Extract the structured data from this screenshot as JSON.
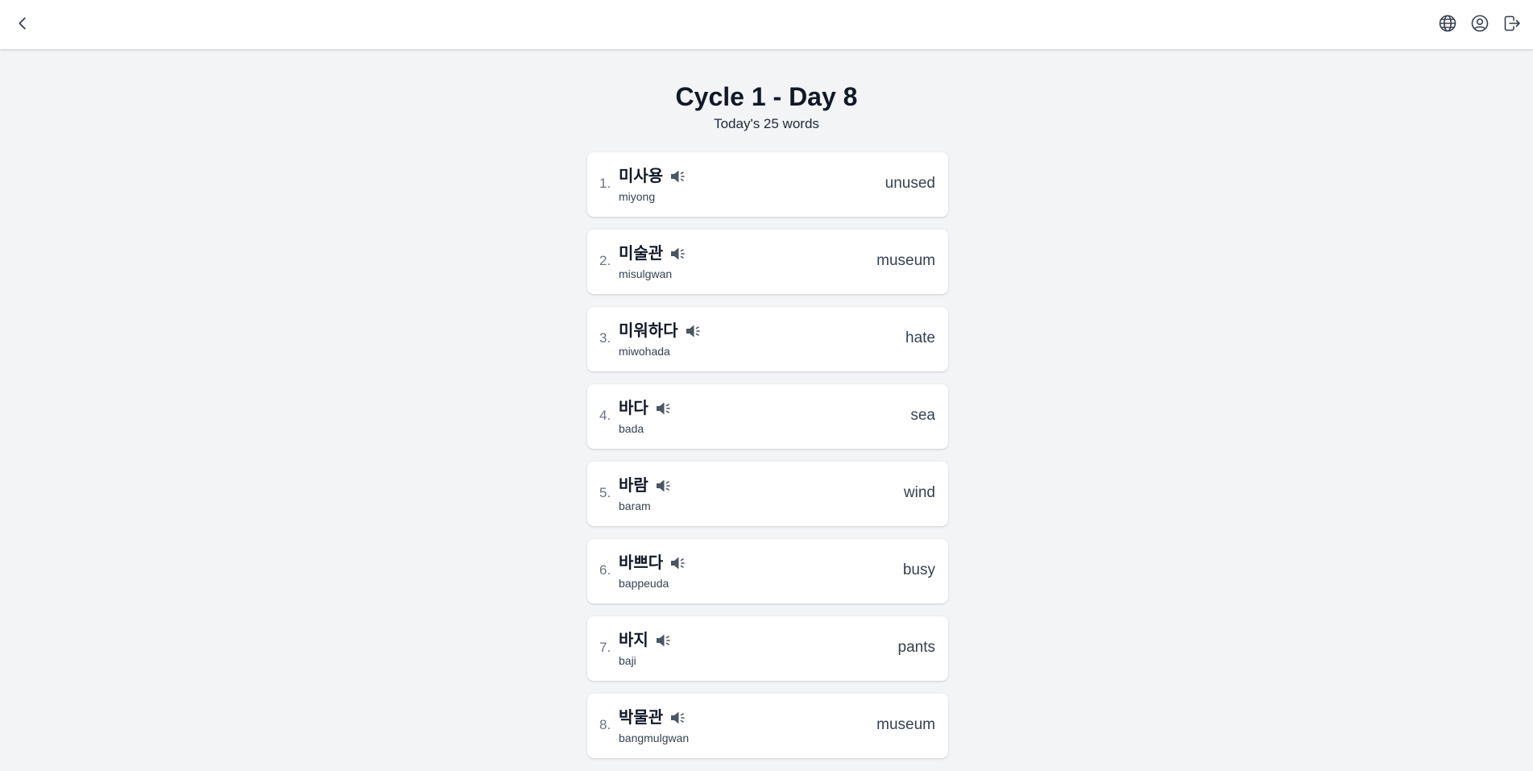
{
  "header": {
    "back_icon": "chevron-left-icon",
    "language_icon": "globe-icon",
    "profile_icon": "user-circle-icon",
    "logout_icon": "logout-icon"
  },
  "page": {
    "title": "Cycle 1 - Day 8",
    "subtitle": "Today's 25 words"
  },
  "words": [
    {
      "num": "1.",
      "korean": "미사용",
      "roman": "miyong",
      "meaning": "unused"
    },
    {
      "num": "2.",
      "korean": "미술관",
      "roman": "misulgwan",
      "meaning": "museum"
    },
    {
      "num": "3.",
      "korean": "미워하다",
      "roman": "miwohada",
      "meaning": "hate"
    },
    {
      "num": "4.",
      "korean": "바다",
      "roman": "bada",
      "meaning": "sea"
    },
    {
      "num": "5.",
      "korean": "바람",
      "roman": "baram",
      "meaning": "wind"
    },
    {
      "num": "6.",
      "korean": "바쁘다",
      "roman": "bappeuda",
      "meaning": "busy"
    },
    {
      "num": "7.",
      "korean": "바지",
      "roman": "baji",
      "meaning": "pants"
    },
    {
      "num": "8.",
      "korean": "박물관",
      "roman": "bangmulgwan",
      "meaning": "museum"
    }
  ],
  "colors": {
    "background": "#f3f4f6",
    "card": "#ffffff",
    "text_primary": "#111827",
    "text_muted": "#6b7280",
    "icon": "#4b5563"
  }
}
